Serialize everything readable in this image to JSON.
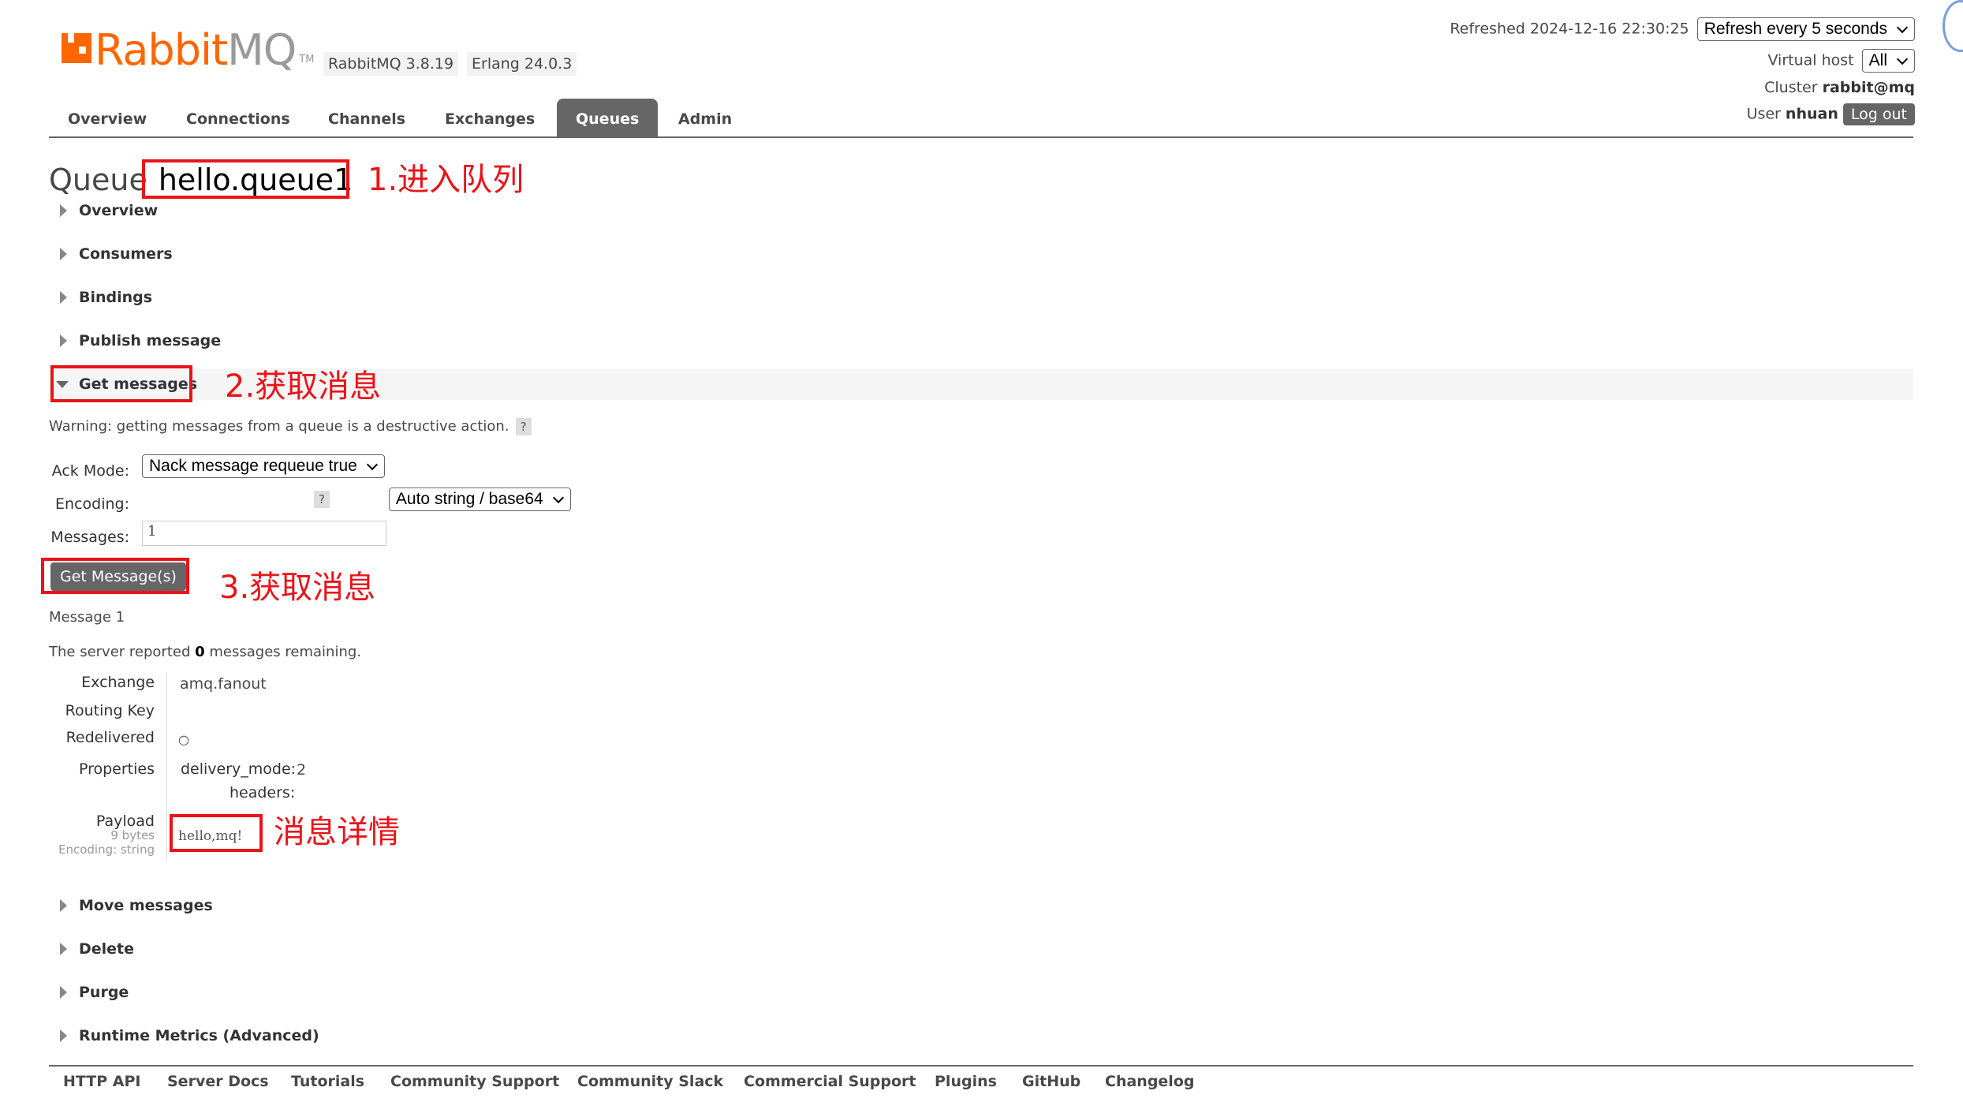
{
  "brand": {
    "logo_main": "Rabbit",
    "logo_mq": "MQ",
    "logo_tm": "TM",
    "version": "RabbitMQ 3.8.19",
    "erlang": "Erlang 24.0.3"
  },
  "header": {
    "refreshed_label": "Refreshed 2024-12-16 22:30:25",
    "refresh_select": "Refresh every 5 seconds",
    "vhost_label": "Virtual host",
    "vhost_select": "All",
    "cluster_label": "Cluster",
    "cluster_name": "rabbit@mq",
    "user_label": "User",
    "user_name": "nhuan",
    "logout": "Log out"
  },
  "nav": {
    "tabs": [
      "Overview",
      "Connections",
      "Channels",
      "Exchanges",
      "Queues",
      "Admin"
    ],
    "active": "Queues"
  },
  "page": {
    "title_prefix": "Queue",
    "queue_name": "hello.queue1"
  },
  "annotations": {
    "a1": "1.进入队列",
    "a2": "2.获取消息",
    "a3": "3.获取消息",
    "a4": "消息详情"
  },
  "sections": {
    "overview": "Overview",
    "consumers": "Consumers",
    "bindings": "Bindings",
    "publish": "Publish message",
    "get": "Get messages",
    "move": "Move messages",
    "delete": "Delete",
    "purge": "Purge",
    "runtime": "Runtime Metrics (Advanced)"
  },
  "get_messages": {
    "warning": "Warning: getting messages from a queue is a destructive action.",
    "help": "?",
    "ack_label": "Ack Mode:",
    "ack_value": "Nack message requeue true",
    "encoding_label": "Encoding:",
    "encoding_value": "Auto string / base64",
    "messages_label": "Messages:",
    "messages_value": "1",
    "button": "Get Message(s)"
  },
  "result": {
    "message_heading": "Message 1",
    "server_pre": "The server reported",
    "server_count": "0",
    "server_post": "messages remaining.",
    "exchange_label": "Exchange",
    "exchange_value": "amq.fanout",
    "routing_label": "Routing Key",
    "routing_value": "",
    "redelivered_label": "Redelivered",
    "redelivered_value": "○",
    "properties_label": "Properties",
    "delivery_mode_key": "delivery_mode:",
    "delivery_mode_val": "2",
    "headers_key": "headers:",
    "payload_label": "Payload",
    "payload_size": "9 bytes",
    "payload_encoding": "Encoding: string",
    "payload_value": "hello,mq!"
  },
  "footer": {
    "links": [
      "HTTP API",
      "Server Docs",
      "Tutorials",
      "Community Support",
      "Community Slack",
      "Commercial Support",
      "Plugins",
      "GitHub",
      "Changelog"
    ]
  }
}
